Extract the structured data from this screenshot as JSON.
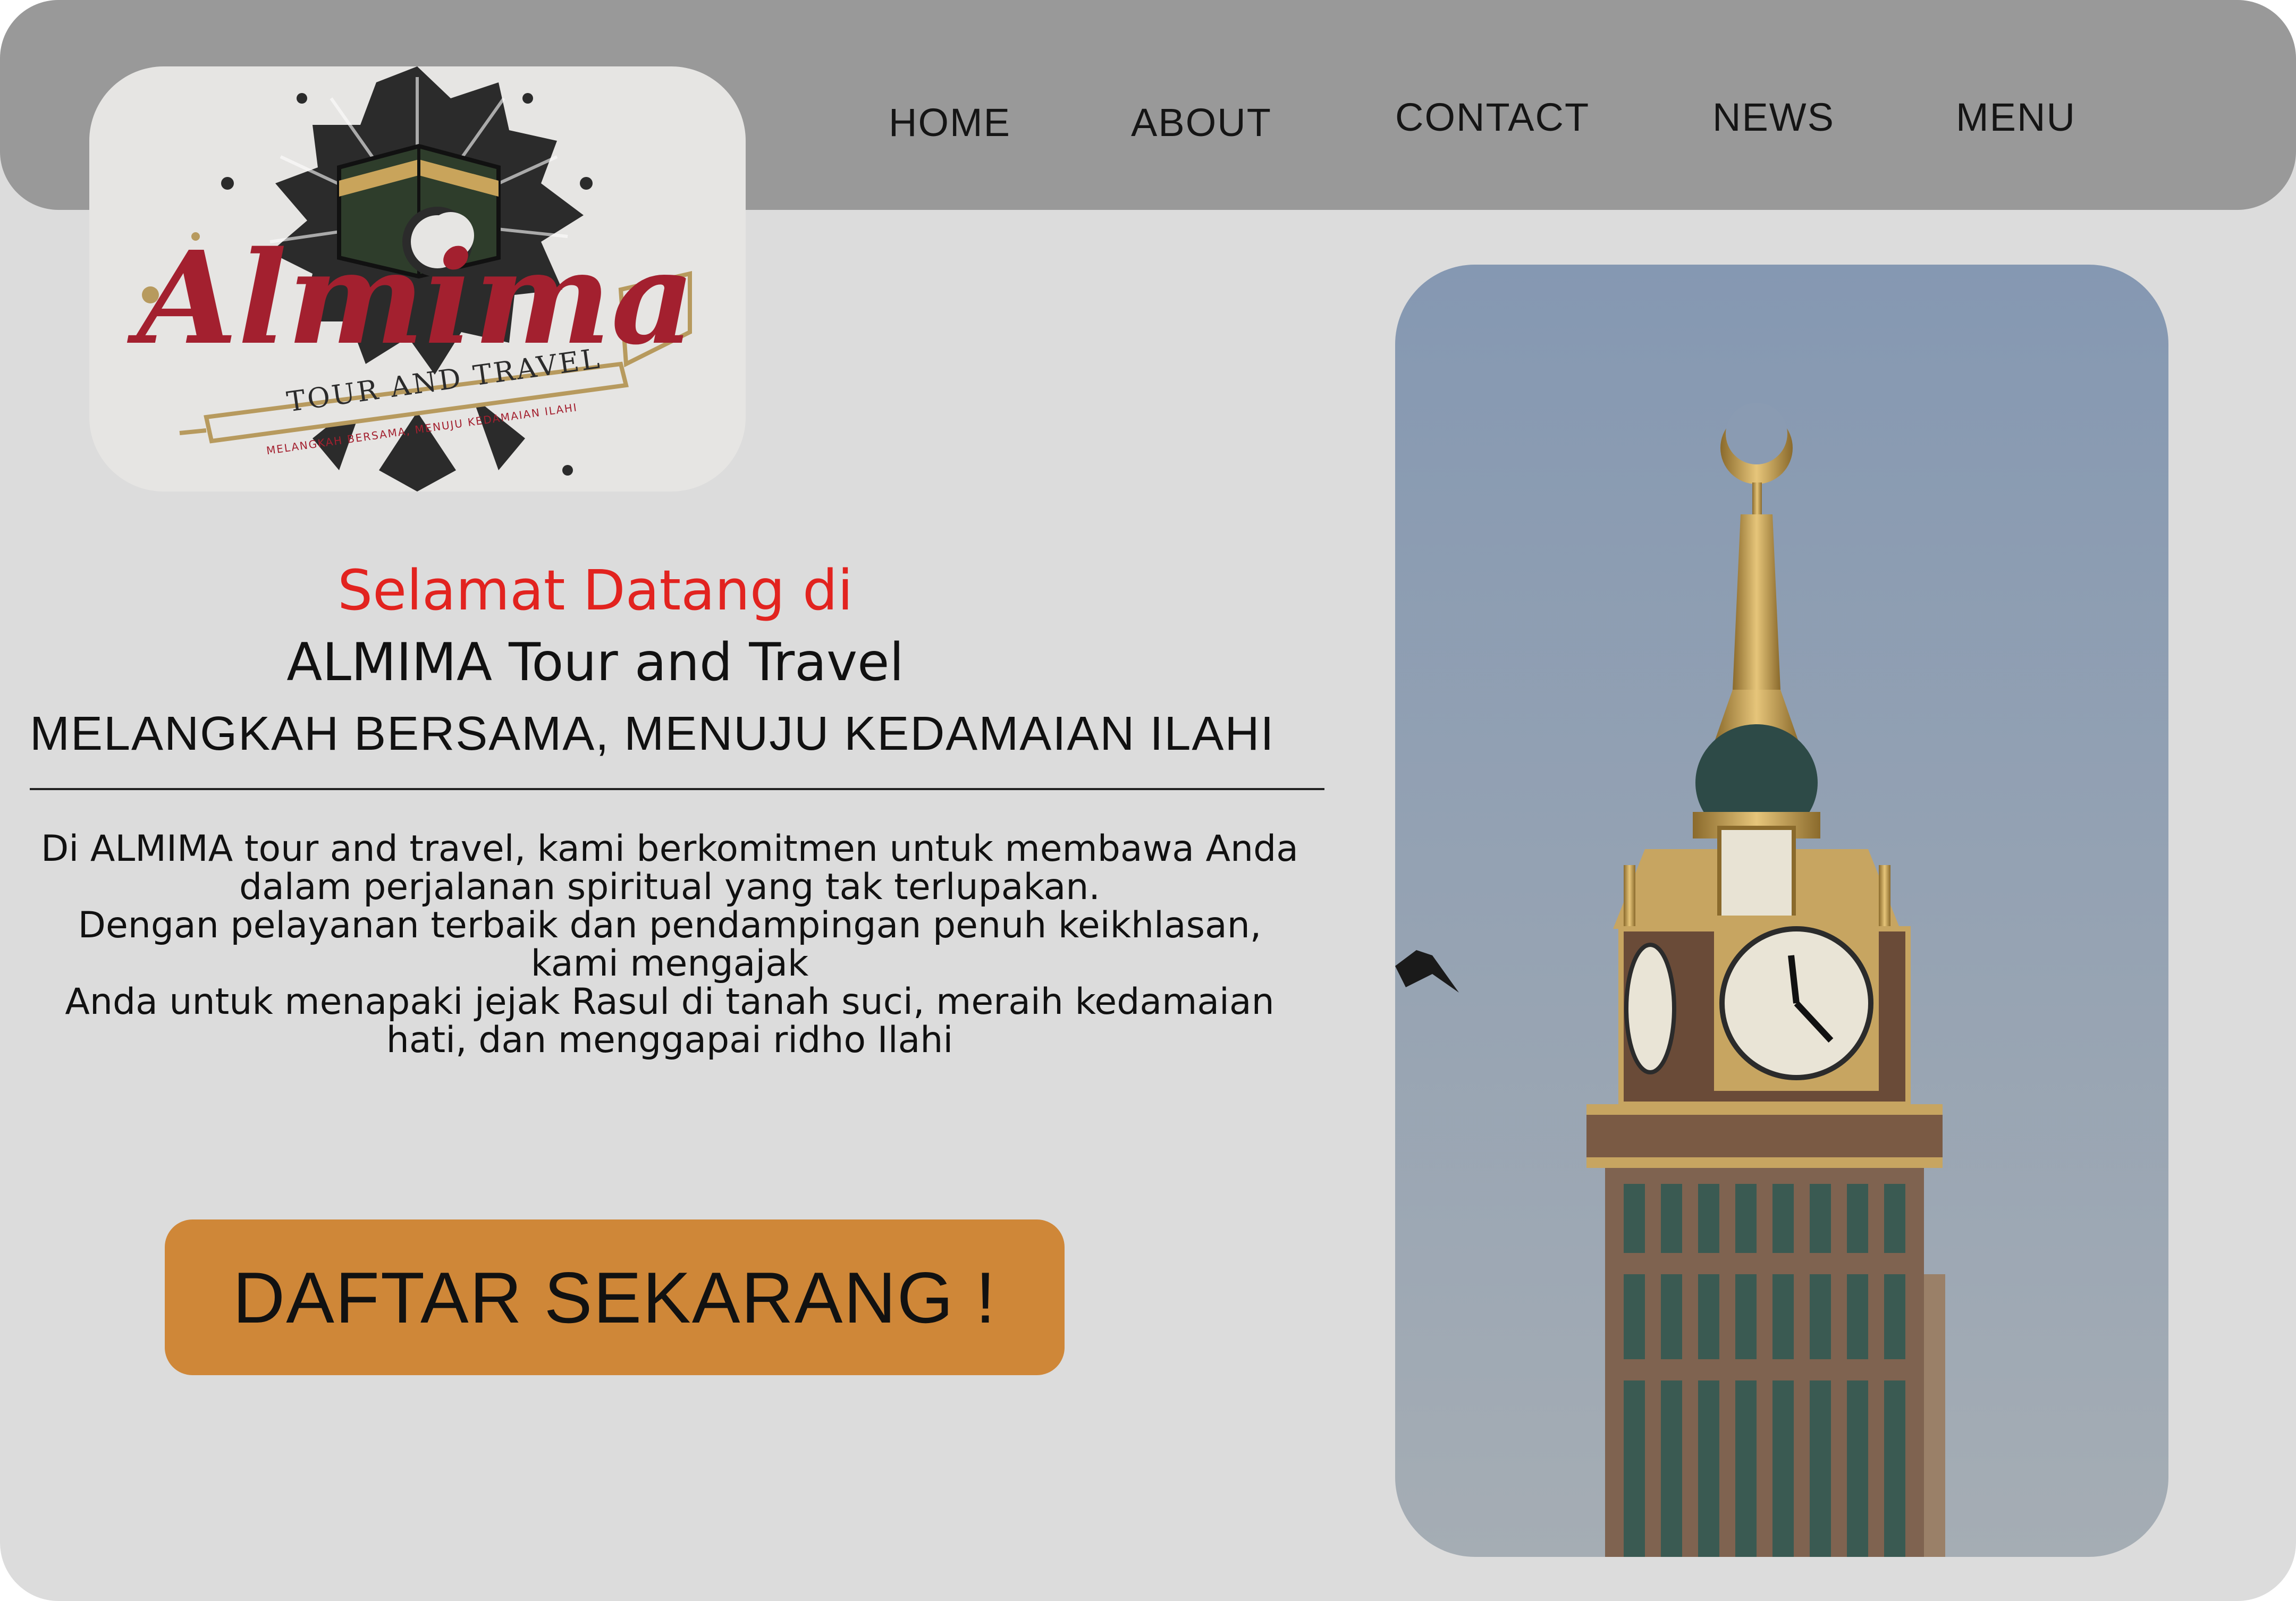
{
  "nav": {
    "items": [
      "HOME",
      "ABOUT",
      "CONTACT",
      "NEWS",
      "MENU"
    ]
  },
  "logo": {
    "brand": "Almima",
    "subtitle": "TOUR AND TRAVEL",
    "motto": "MELANGKAH BERSAMA, MENUJU KEDAMAIAN ILAHI"
  },
  "hero": {
    "welcome": "Selamat Datang di",
    "company": "ALMIMA Tour and Travel",
    "tagline": "MELANGKAH BERSAMA, MENUJU KEDAMAIAN ILAHI",
    "description": "Di ALMIMA tour and travel, kami berkomitmen untuk membawa Anda\ndalam perjalanan spiritual yang tak terlupakan.\nDengan pelayanan terbaik dan pendampingan penuh keikhlasan,\nkami mengajak\nAnda untuk menapaki jejak Rasul di tanah suci, meraih kedamaian\nhati, dan menggapai ridho Ilahi",
    "cta_label": "DAFTAR SEKARANG !"
  },
  "colors": {
    "page_bg": "#dcdcdc",
    "topbar": "#999999",
    "accent_red": "#e2231f",
    "cta": "#cf8738",
    "logo_red": "#a3202f",
    "logo_gold": "#b79a5e"
  }
}
